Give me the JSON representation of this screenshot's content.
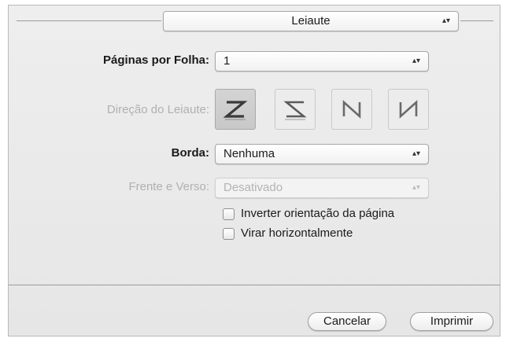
{
  "panel_selector": {
    "value": "Leiaute"
  },
  "pages_per_sheet": {
    "label": "Páginas por Folha:",
    "value": "1"
  },
  "layout_direction": {
    "label": "Direção do Leiaute:"
  },
  "border": {
    "label": "Borda:",
    "value": "Nenhuma"
  },
  "two_sided": {
    "label": "Frente e Verso:",
    "value": "Desativado"
  },
  "options": {
    "reverse_orientation": "Inverter orientação da página",
    "flip_horizontally": "Virar horizontalmente"
  },
  "buttons": {
    "cancel": "Cancelar",
    "print": "Imprimir"
  },
  "icons": {
    "dir1": "layout-direction-z-icon",
    "dir2": "layout-direction-reverse-z-icon",
    "dir3": "layout-direction-n-icon",
    "dir4": "layout-direction-reverse-n-icon",
    "stepper": "popup-arrows-icon"
  },
  "colors": {
    "dialog_bg": "#e9e9e9",
    "disabled_text": "#b0b0b0"
  }
}
